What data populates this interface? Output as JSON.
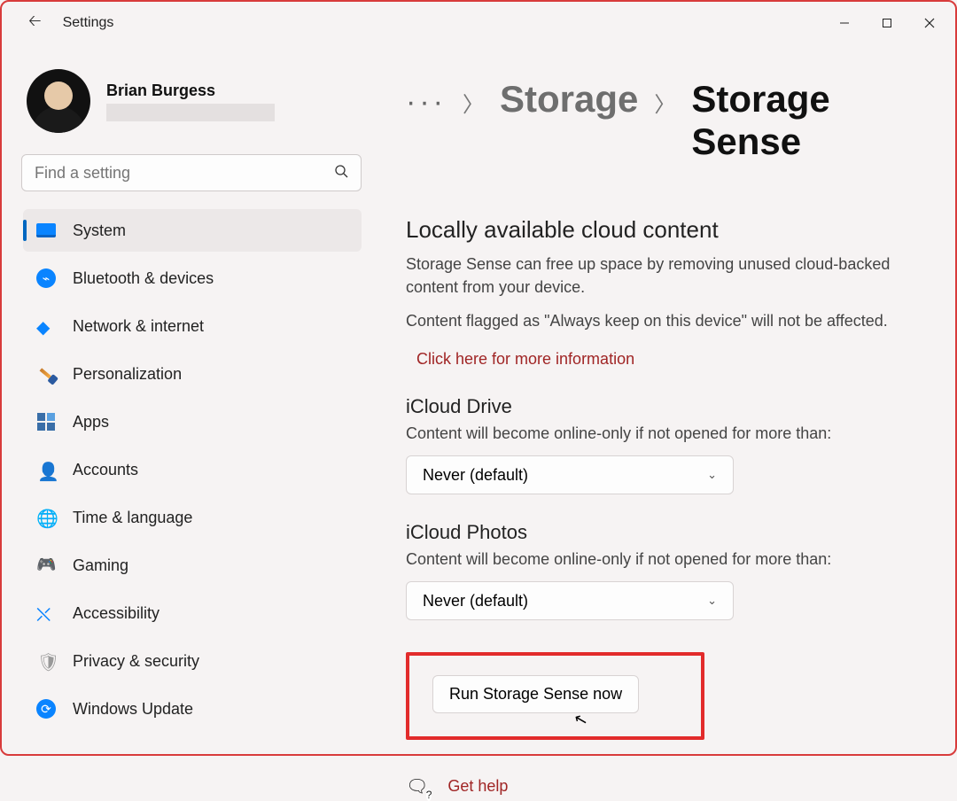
{
  "titlebar": {
    "title": "Settings"
  },
  "profile": {
    "name": "Brian Burgess"
  },
  "search": {
    "placeholder": "Find a setting"
  },
  "nav": [
    {
      "label": "System",
      "icon": "monitor-icon",
      "selected": true
    },
    {
      "label": "Bluetooth & devices",
      "icon": "bluetooth-icon"
    },
    {
      "label": "Network & internet",
      "icon": "wifi-icon"
    },
    {
      "label": "Personalization",
      "icon": "brush-icon"
    },
    {
      "label": "Apps",
      "icon": "apps-icon"
    },
    {
      "label": "Accounts",
      "icon": "account-icon"
    },
    {
      "label": "Time & language",
      "icon": "clock-icon"
    },
    {
      "label": "Gaming",
      "icon": "gamepad-icon"
    },
    {
      "label": "Accessibility",
      "icon": "accessibility-icon"
    },
    {
      "label": "Privacy & security",
      "icon": "shield-icon"
    },
    {
      "label": "Windows Update",
      "icon": "update-icon"
    }
  ],
  "breadcrumb": {
    "ellipsis": "···",
    "item1": "Storage",
    "current": "Storage Sense"
  },
  "cloud": {
    "heading": "Locally available cloud content",
    "body1": "Storage Sense can free up space by removing unused cloud-backed content from your device.",
    "body2": "Content flagged as \"Always keep on this device\" will not be affected.",
    "info_link": "Click here for more information"
  },
  "icloud_drive": {
    "title": "iCloud Drive",
    "subtitle": "Content will become online-only if not opened for more than:",
    "value": "Never (default)"
  },
  "icloud_photos": {
    "title": "iCloud Photos",
    "subtitle": "Content will become online-only if not opened for more than:",
    "value": "Never (default)"
  },
  "run_button": "Run Storage Sense now",
  "help": {
    "text": "Get help"
  }
}
